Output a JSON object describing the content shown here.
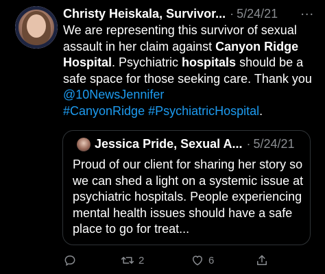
{
  "tweet": {
    "author_name": "Christy Heiskala, Survivor...",
    "separator": "·",
    "date": "5/24/21",
    "more_icon": "...",
    "text": {
      "p1": "We are representing this survivor of sexual assault in her claim against ",
      "p2_bold": "Canyon Ridge Hospital",
      "p3": ". Psychiatric ",
      "p4_bold": "hospitals",
      "p5": " should be a safe space for those seeking care. Thank you ",
      "mention": "@10NewsJennifer",
      "hashtag1": "#CanyonRidge",
      "hashtag2": "#PsychiatricHospital",
      "end": "."
    },
    "link_color": "#1d9bf0"
  },
  "quote": {
    "author_name": "Jessica Pride, Sexual A...",
    "separator": "·",
    "date": "5/24/21",
    "text": "Proud of our client for sharing her story so we can shed a light on a systemic issue at psychiatric hospitals. People experiencing mental health issues should have a safe place to go for treat..."
  },
  "actions": {
    "reply_icon": "reply-icon",
    "retweet_icon": "retweet-icon",
    "retweet_count": "2",
    "like_icon": "heart-icon",
    "like_count": "6",
    "share_icon": "share-icon"
  }
}
